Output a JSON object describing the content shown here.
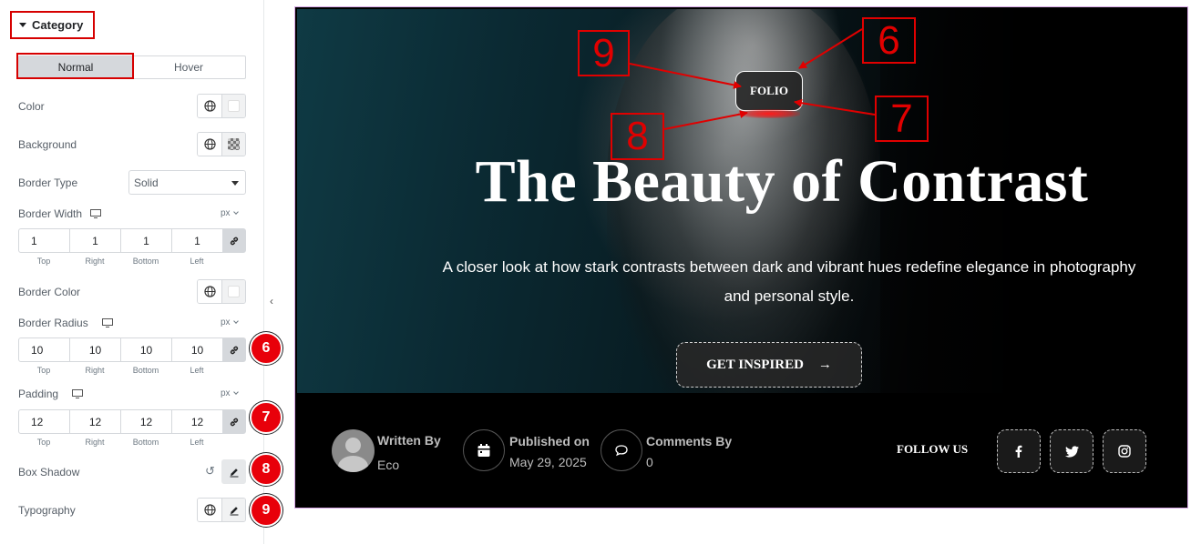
{
  "panel": {
    "section_title": "Category",
    "tabs": [
      {
        "label": "Normal",
        "active": true
      },
      {
        "label": "Hover",
        "active": false
      }
    ],
    "color_label": "Color",
    "background_label": "Background",
    "border_type_label": "Border Type",
    "border_type_value": "Solid",
    "border_width_label": "Border Width",
    "border_width_unit": "px",
    "border_width": [
      "1",
      "1",
      "1",
      "1"
    ],
    "dim_labels": [
      "Top",
      "Right",
      "Bottom",
      "Left"
    ],
    "border_color_label": "Border Color",
    "border_radius_label": "Border Radius",
    "border_radius_unit": "px",
    "border_radius": [
      "10",
      "10",
      "10",
      "10"
    ],
    "padding_label": "Padding",
    "padding_unit": "px",
    "padding": [
      "12",
      "12",
      "12",
      "12"
    ],
    "box_shadow_label": "Box Shadow",
    "typography_label": "Typography",
    "badges": [
      "6",
      "7",
      "8",
      "9"
    ]
  },
  "preview": {
    "category": "FOLIO",
    "title": "The Beauty of Contrast",
    "subtitle": "A closer look at how stark contrasts between dark and vibrant hues redefine elegance in photography and personal style.",
    "cta_label": "GET INSPIRED",
    "cta_arrow": "→",
    "written_by_label": "Written By",
    "author": "Eco",
    "published_label": "Published on",
    "published_date": "May 29, 2025",
    "comments_label": "Comments By",
    "comments_count": "0",
    "follow_label": "FOLLOW US",
    "social_icons": [
      "facebook-icon",
      "twitter-icon",
      "instagram-icon"
    ]
  },
  "annotations": [
    "9",
    "6",
    "8",
    "7"
  ],
  "colors": {
    "annotation_red": "#e00000",
    "badge_red": "#e8000a",
    "preview_border": "#d9a8e8"
  }
}
